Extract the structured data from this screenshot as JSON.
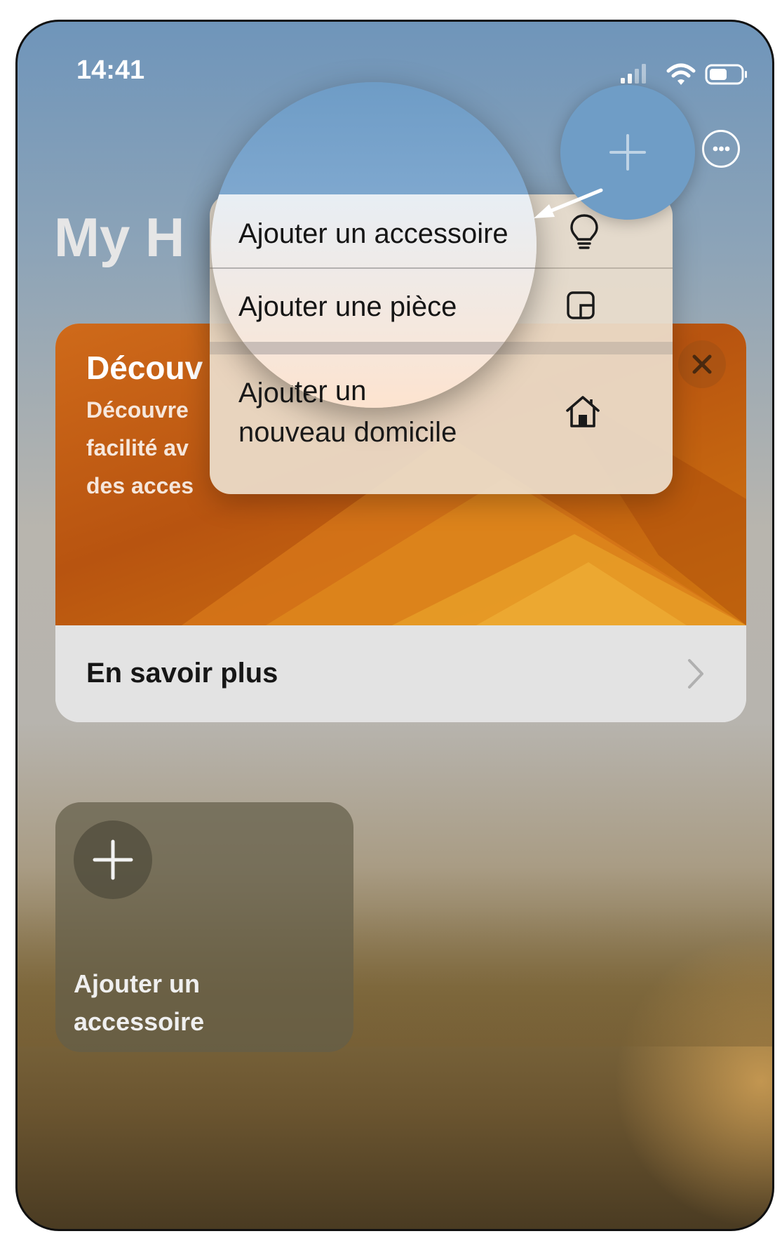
{
  "status_bar": {
    "time": "14:41",
    "icons": [
      "cellular-signal-icon",
      "wifi-icon",
      "battery-icon"
    ]
  },
  "header": {
    "title": "My Home",
    "title_visible": "My H",
    "add_button_icon": "plus-icon",
    "more_button_icon": "ellipsis-circle-icon"
  },
  "add_menu": {
    "items": [
      {
        "label": "Ajouter un accessoire",
        "icon": "lightbulb-icon"
      },
      {
        "label": "Ajouter une pièce",
        "icon": "room-icon"
      },
      {
        "label_line1": "Ajouter un",
        "label_line2": "nouveau domicile",
        "icon": "house-icon"
      }
    ]
  },
  "promo_card": {
    "title": "Découv",
    "body_line1": "Découvre",
    "body_line2": "facilité av",
    "body_line3": "des acces",
    "close_icon": "close-icon",
    "link_label": "En savoir plus",
    "link_icon": "chevron-right-icon"
  },
  "add_tile": {
    "icon": "plus-icon",
    "label": "Ajouter un accessoire"
  },
  "colors": {
    "accent_blue": "#6f9dc6",
    "promo_orange": "#c45d14",
    "menu_background": "#ecdccd"
  }
}
